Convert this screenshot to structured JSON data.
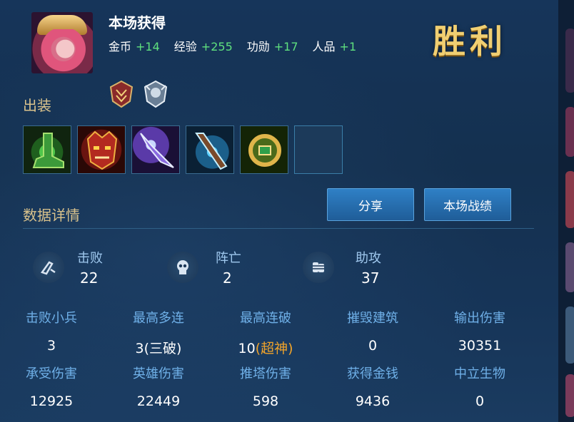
{
  "header": {
    "title": "本场获得",
    "rewards": [
      {
        "label": "金币",
        "value": "+14"
      },
      {
        "label": "经验",
        "value": "+255"
      },
      {
        "label": "功勋",
        "value": "+17"
      },
      {
        "label": "人品",
        "value": "+1"
      }
    ],
    "result": "胜利"
  },
  "equipment": {
    "title": "出装",
    "items": [
      {
        "icon": "green-boots-icon"
      },
      {
        "icon": "red-demon-mask-icon"
      },
      {
        "icon": "purple-blade-icon"
      },
      {
        "icon": "frost-staff-icon"
      },
      {
        "icon": "gold-ring-icon"
      },
      {
        "icon": "empty-slot"
      }
    ]
  },
  "details": {
    "title": "数据详情",
    "share_label": "分享",
    "record_label": "本场战绩"
  },
  "kda": [
    {
      "label": "击败",
      "value": "22",
      "icon": "kill-icon"
    },
    {
      "label": "阵亡",
      "value": "2",
      "icon": "skull-icon"
    },
    {
      "label": "助攻",
      "value": "37",
      "icon": "assist-fist-icon"
    }
  ],
  "stats": [
    {
      "label": "击败小兵",
      "value": "3"
    },
    {
      "label": "最高多连",
      "value": "3(三破)"
    },
    {
      "label": "最高连破",
      "value": "10",
      "suffix": "(超神)"
    },
    {
      "label": "摧毁建筑",
      "value": "0"
    },
    {
      "label": "输出伤害",
      "value": "30351"
    },
    {
      "label": "承受伤害",
      "value": "12925"
    },
    {
      "label": "英雄伤害",
      "value": "22449"
    },
    {
      "label": "推塔伤害",
      "value": "598"
    },
    {
      "label": "获得金钱",
      "value": "9436"
    },
    {
      "label": "中立生物",
      "value": "0"
    }
  ],
  "colors": {
    "reward_value": "#5fe07e",
    "victory": "#f0cf72",
    "stat_label": "#6fb0e8",
    "accent_orange": "#f0a32a"
  }
}
